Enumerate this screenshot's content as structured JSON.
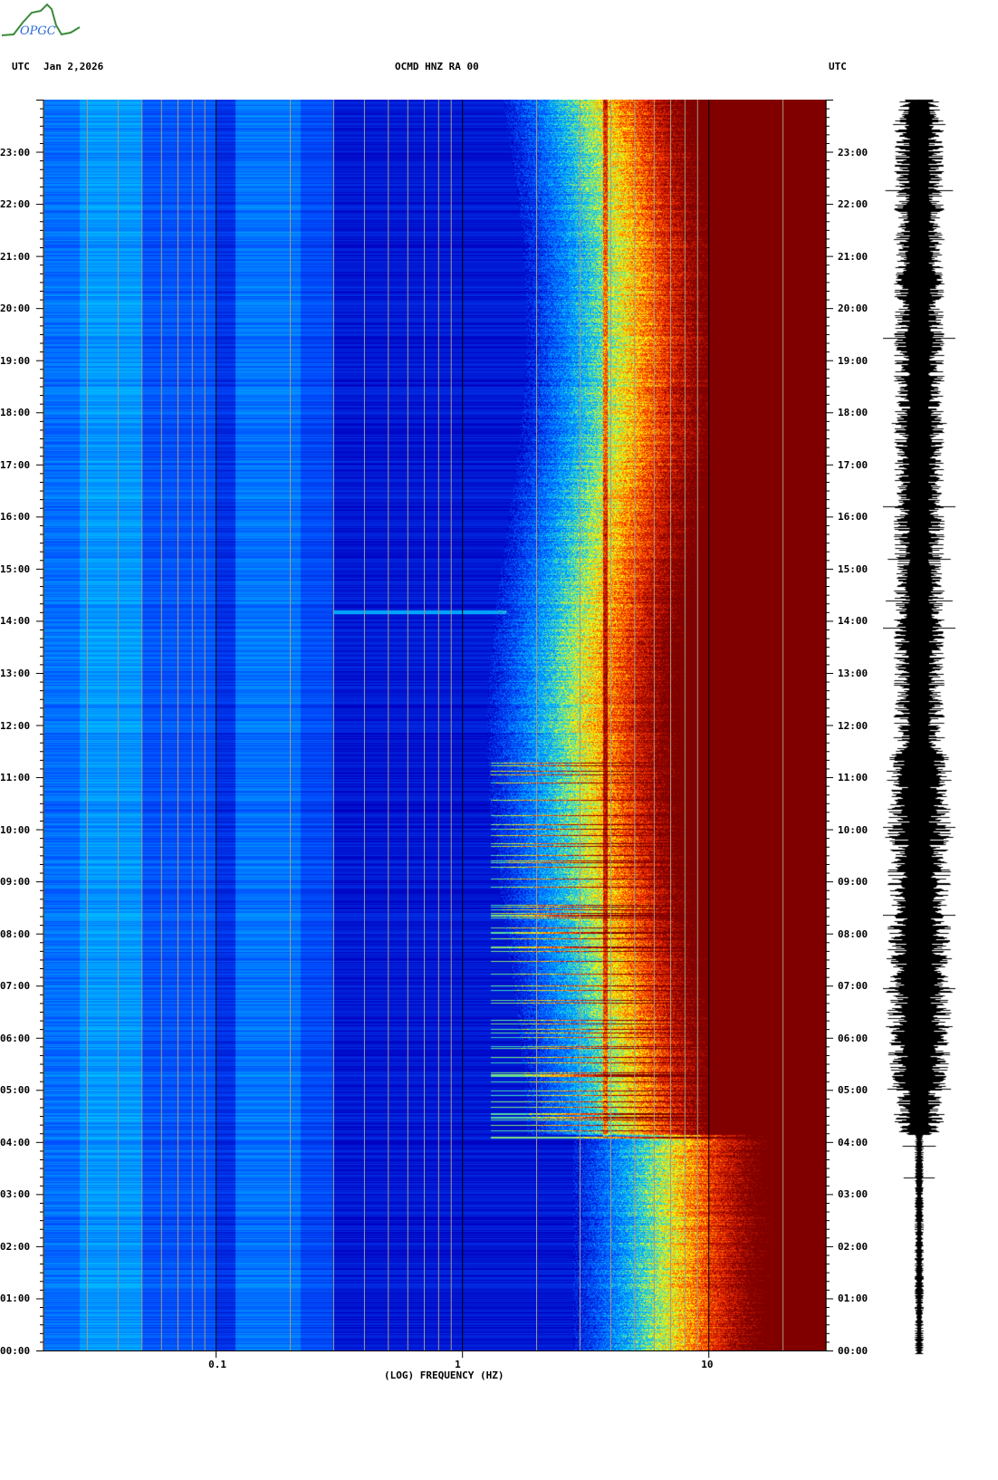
{
  "logo": {
    "text": "OPGC"
  },
  "header": {
    "left_utc": "UTC",
    "date": "Jan 2,2026",
    "station": "OCMD HNZ RA 00",
    "right_utc": "UTC"
  },
  "chart_data": {
    "type": "heatmap",
    "title": "OCMD HNZ RA 00",
    "xlabel": "(LOG) FREQUENCY (HZ)",
    "x_scale": "log",
    "xlim": [
      0.02,
      30
    ],
    "x_ticks": [
      {
        "value": 0.1,
        "label": "0.1"
      },
      {
        "value": 1,
        "label": "1"
      },
      {
        "value": 10,
        "label": "10"
      }
    ],
    "ylabel": "UTC",
    "ylim_hours": [
      0,
      24
    ],
    "y_ticks": [
      "00:00",
      "01:00",
      "02:00",
      "03:00",
      "04:00",
      "05:00",
      "06:00",
      "07:00",
      "08:00",
      "09:00",
      "10:00",
      "11:00",
      "12:00",
      "13:00",
      "14:00",
      "15:00",
      "16:00",
      "17:00",
      "18:00",
      "19:00",
      "20:00",
      "21:00",
      "22:00",
      "23:00"
    ],
    "colormap": [
      "#0000c0",
      "#0050ff",
      "#00c8ff",
      "#ffff00",
      "#ff3000",
      "#800000"
    ],
    "features": [
      {
        "type": "narrow line",
        "freq_hz": 0.7,
        "time": "14:10"
      },
      {
        "type": "broadband onset",
        "time": "04:10"
      },
      {
        "type": "persistent line",
        "freq_hz": 3.8,
        "time_range": [
          "04:10",
          "24:00"
        ]
      }
    ]
  }
}
